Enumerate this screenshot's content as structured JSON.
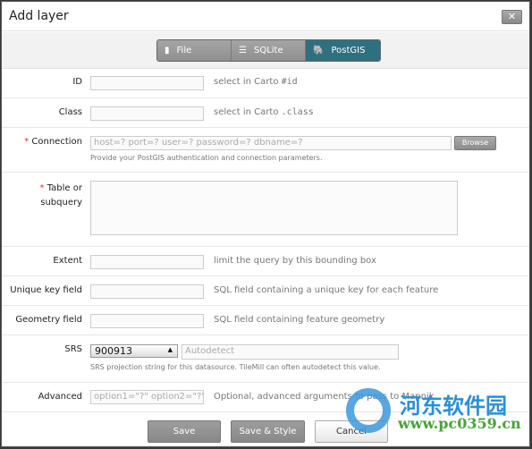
{
  "dialog": {
    "title": "Add layer",
    "close_label": "✕"
  },
  "tabs": [
    {
      "label": "File",
      "icon": "file-icon"
    },
    {
      "label": "SQLite",
      "icon": "database-icon"
    },
    {
      "label": "PostGIS",
      "icon": "elephant-icon",
      "active": true
    }
  ],
  "fields": {
    "id": {
      "label": "ID",
      "value": "",
      "hint_prefix": "select in Carto ",
      "hint_code": "#id"
    },
    "class": {
      "label": "Class",
      "value": "",
      "hint_prefix": "select in Carto ",
      "hint_code": ".class"
    },
    "connection": {
      "required": "*",
      "label": "Connection",
      "placeholder": "host=? port=? user=? password=? dbname=?",
      "browse_label": "Browse",
      "help": "Provide your PostGIS authentication and connection parameters."
    },
    "table": {
      "required": "*",
      "label_line1": "Table or",
      "label_line2": "subquery",
      "value": ""
    },
    "extent": {
      "label": "Extent",
      "value": "",
      "hint": "limit the query by this bounding box"
    },
    "unique_key": {
      "label": "Unique key field",
      "value": "",
      "hint": "SQL field containing a unique key for each feature"
    },
    "geometry": {
      "label": "Geometry field",
      "value": "",
      "hint": "SQL field containing feature geometry"
    },
    "srs": {
      "label": "SRS",
      "selected": "900913",
      "placeholder": "Autodetect",
      "help": "SRS projection string for this datasource. TileMill can often autodetect this value."
    },
    "advanced": {
      "label": "Advanced",
      "placeholder": "option1=\"?\" option2=\"?\"",
      "hint": "Optional, advanced arguments to pass to Mapnik."
    }
  },
  "buttons": {
    "save": "Save",
    "save_style": "Save & Style",
    "cancel": "Cancel"
  },
  "watermark": {
    "name": "河东软件园",
    "url": "www.pc0359.cn"
  }
}
